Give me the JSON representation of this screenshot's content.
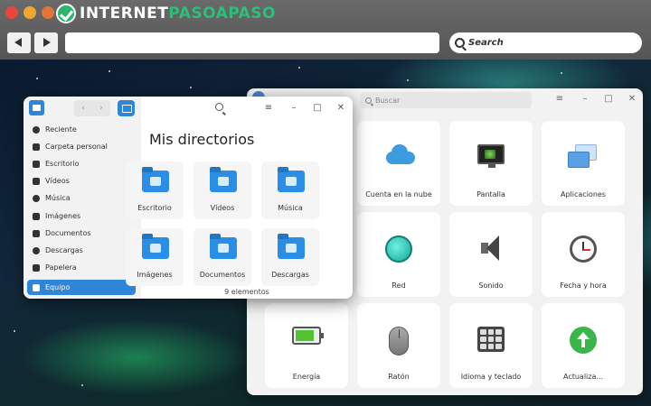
{
  "site": {
    "logo_part1": "INTERNET",
    "logo_part2": "PASOAPASO",
    "search_label": "Search"
  },
  "files_window": {
    "title": "Mis directorios",
    "status": "9 elementos",
    "sidebar": [
      {
        "label": "Reciente",
        "icon": "clock-icon"
      },
      {
        "label": "Carpeta personal",
        "icon": "home-icon"
      },
      {
        "label": "Escritorio",
        "icon": "desktop-icon"
      },
      {
        "label": "Vídeos",
        "icon": "video-icon"
      },
      {
        "label": "Música",
        "icon": "music-icon"
      },
      {
        "label": "Imágenes",
        "icon": "image-icon"
      },
      {
        "label": "Documentos",
        "icon": "document-icon"
      },
      {
        "label": "Descargas",
        "icon": "download-icon"
      },
      {
        "label": "Papelera",
        "icon": "trash-icon"
      },
      {
        "label": "Equipo",
        "icon": "computer-icon",
        "active": true
      }
    ],
    "folders": [
      {
        "label": "Escritorio"
      },
      {
        "label": "Vídeos"
      },
      {
        "label": "Música"
      },
      {
        "label": "Imágenes"
      },
      {
        "label": "Documentos"
      },
      {
        "label": "Descargas"
      }
    ]
  },
  "settings_window": {
    "search_placeholder": "Buscar",
    "tiles": [
      {
        "label": "Cuenta en la nube",
        "icon": "cloud-icon"
      },
      {
        "label": "Pantalla",
        "icon": "monitor-icon"
      },
      {
        "label": "Aplicaciones",
        "icon": "apps-icon"
      },
      {
        "label": "Red",
        "icon": "network-globe-icon"
      },
      {
        "label": "Sonido",
        "icon": "speaker-icon"
      },
      {
        "label": "Fecha y hora",
        "icon": "clock-icon"
      },
      {
        "label": "Energía",
        "icon": "battery-icon"
      },
      {
        "label": "Ratón",
        "icon": "mouse-icon"
      },
      {
        "label": "Idioma y teclado",
        "icon": "keyboard-icon"
      },
      {
        "label": "Actualiza...",
        "icon": "update-icon"
      }
    ]
  },
  "colors": {
    "accent": "#2f86d8",
    "brand_green": "#29c07a"
  }
}
